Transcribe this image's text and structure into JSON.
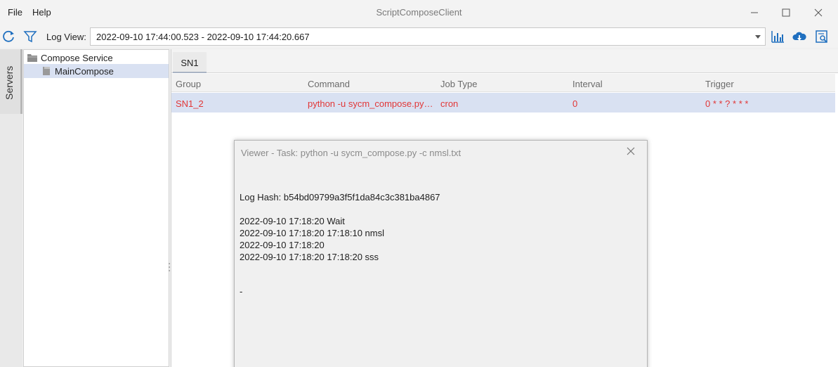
{
  "menu": {
    "file": "File",
    "help": "Help"
  },
  "window": {
    "title": "ScriptComposeClient"
  },
  "toolbar": {
    "log_view_label": "Log View:",
    "log_view_value": "2022-09-10 17:44:00.523 - 2022-09-10 17:44:20.667",
    "icons": [
      "refresh-icon",
      "filter-icon",
      "chart-icon",
      "cloud-download-icon",
      "search-document-icon"
    ]
  },
  "sidebar": {
    "servers_label": "Servers"
  },
  "tree": {
    "items": [
      {
        "label": "Compose Service",
        "icon": "folder-icon"
      },
      {
        "label": "MainCompose",
        "icon": "file-icon",
        "selected": true
      }
    ]
  },
  "tabs": [
    {
      "label": "SN1"
    }
  ],
  "table": {
    "headers": [
      "Group",
      "Command",
      "Job Type",
      "Interval",
      "Trigger"
    ],
    "rows": [
      {
        "group": "SN1_2",
        "command": "python -u sycm_compose.py -c nmsl.txt",
        "job_type": "cron",
        "interval": "0",
        "trigger": "0 * * ? * * *"
      }
    ]
  },
  "viewer": {
    "title": "Viewer - Task: python -u sycm_compose.py -c nmsl.txt",
    "log_hash": "Log Hash: b54bd09799a3f5f1da84c3c381ba4867",
    "lines": [
      "2022-09-10 17:18:20 Wait",
      "2022-09-10 17:18:20 17:18:10 nmsl",
      "2022-09-10 17:18:20",
      "2022-09-10 17:18:20 17:18:20 sss"
    ],
    "tail": "-"
  },
  "colors": {
    "accent": "#1f6fbf",
    "selection": "#d9e1f2",
    "error_text": "#e23737"
  }
}
